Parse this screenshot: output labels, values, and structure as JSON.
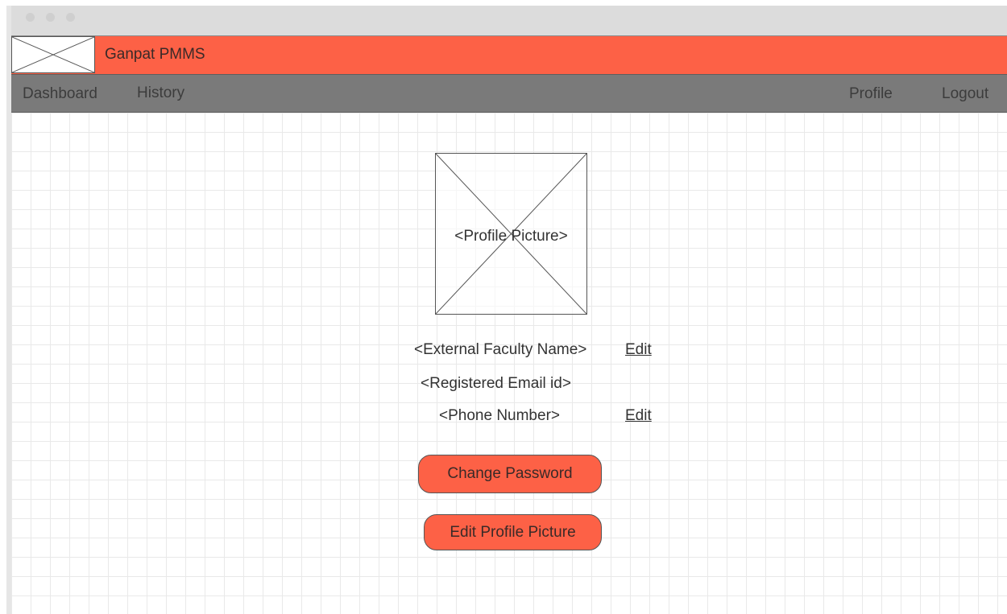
{
  "app": {
    "title": "Ganpat PMMS"
  },
  "nav": {
    "dashboard": "Dashboard",
    "history": "History",
    "profile": "Profile",
    "logout": "Logout"
  },
  "profile": {
    "picture_placeholder": "<Profile Picture>",
    "name_placeholder": "<External Faculty Name>",
    "email_placeholder": "<Registered Email id>",
    "phone_placeholder": "<Phone Number>",
    "edit_name_label": "Edit",
    "edit_phone_label": "Edit"
  },
  "actions": {
    "change_password": "Change Password",
    "edit_profile_picture": "Edit Profile Picture"
  },
  "colors": {
    "accent": "#fd6146",
    "navbar": "#7a7a7a"
  },
  "icons": {
    "logo": "image-placeholder-icon",
    "profile_picture": "image-placeholder-icon"
  }
}
